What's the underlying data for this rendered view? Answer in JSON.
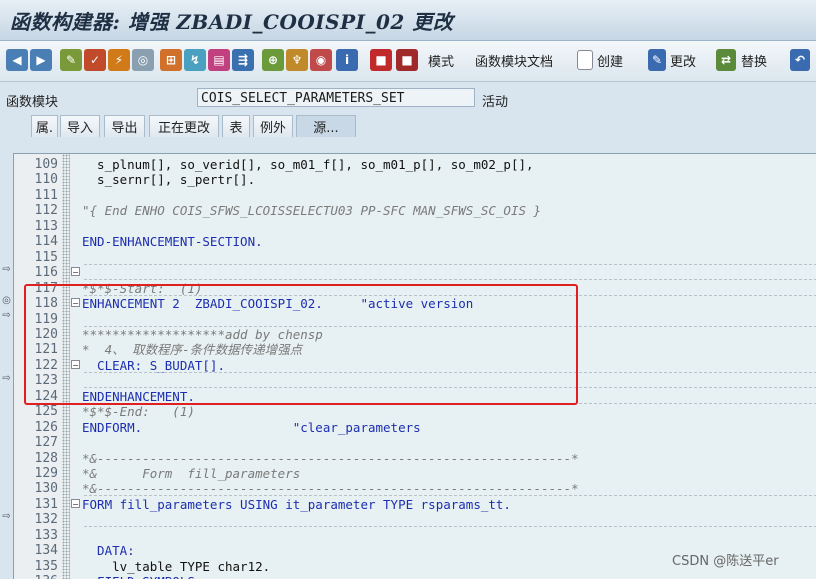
{
  "window": {
    "title": "函数构建器: 增强 ZBADI_COOISPI_02 更改"
  },
  "toolbar": {
    "mode_label": "模式",
    "docs_label": "函数模块文档",
    "create_label": "创建",
    "change_label": "更改",
    "replace_label": "替换"
  },
  "function_module": {
    "label": "函数模块",
    "value": "COIS_SELECT_PARAMETERS_SET",
    "status": "活动"
  },
  "tabs": [
    {
      "label": "属."
    },
    {
      "label": "导入"
    },
    {
      "label": "导出"
    },
    {
      "label": "正在更改"
    },
    {
      "label": "表"
    },
    {
      "label": "例外"
    },
    {
      "label": "源..."
    }
  ],
  "code_lines": [
    {
      "no": "109",
      "text": "  s_plnum[], so_verid[], so_m01_f[], so_m01_p[], so_m02_p[],"
    },
    {
      "no": "110",
      "text": "  s_sernr[], s_pertr[]."
    },
    {
      "no": "111",
      "text": ""
    },
    {
      "no": "112",
      "text": "\"{ End ENHO COIS_SFWS_LCOISSELECTU03 PP-SFC MAN_SFWS_SC_OIS }"
    },
    {
      "no": "113",
      "text": ""
    },
    {
      "no": "114",
      "text": "END-ENHANCEMENT-SECTION."
    },
    {
      "no": "115",
      "text": ""
    },
    {
      "no": "116",
      "text": ""
    },
    {
      "no": "117",
      "text": "*$*$-Start:  (1)"
    },
    {
      "no": "118",
      "text": "ENHANCEMENT 2  ZBADI_COOISPI_02.     \"active version"
    },
    {
      "no": "119",
      "text": ""
    },
    {
      "no": "120",
      "text": "*******************add by chensp"
    },
    {
      "no": "121",
      "text": "*  4、 取数程序-条件数据传递增强点"
    },
    {
      "no": "122",
      "text": "  CLEAR: S_BUDAT[]."
    },
    {
      "no": "123",
      "text": ""
    },
    {
      "no": "124",
      "text": "ENDENHANCEMENT."
    },
    {
      "no": "125",
      "text": "*$*$-End:   (1)"
    },
    {
      "no": "126",
      "text": "ENDFORM.                    \"clear_parameters"
    },
    {
      "no": "127",
      "text": ""
    },
    {
      "no": "128",
      "text": "*&---------------------------------------------------------------*"
    },
    {
      "no": "129",
      "text": "*&      Form  fill_parameters"
    },
    {
      "no": "130",
      "text": "*&---------------------------------------------------------------*"
    },
    {
      "no": "131",
      "text": "FORM fill_parameters USING it_parameter TYPE rsparams_tt."
    },
    {
      "no": "132",
      "text": ""
    },
    {
      "no": "133",
      "text": ""
    },
    {
      "no": "134",
      "text": "  DATA:"
    },
    {
      "no": "135",
      "text": "    lv_table TYPE char12."
    },
    {
      "no": "136",
      "text": "  FIELD-SYMBOLS:"
    }
  ],
  "watermark": "CSDN @陈送平er",
  "colors": {
    "keyword": "#1d2fb0",
    "comment": "#7a7a7a",
    "highlight_box": "#e02020"
  }
}
